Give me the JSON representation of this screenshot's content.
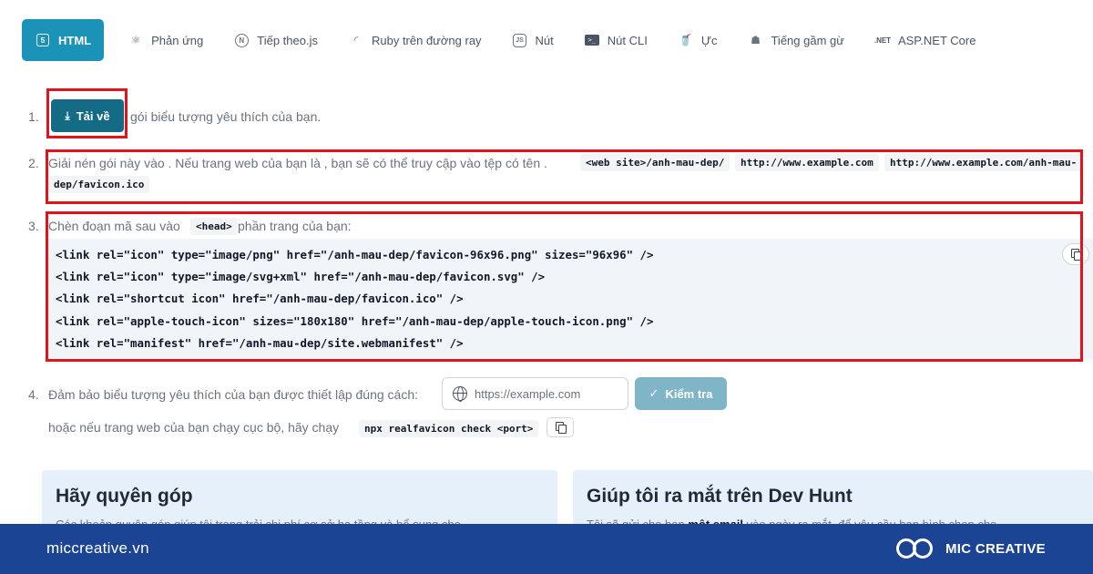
{
  "tabs": [
    {
      "label": "HTML",
      "icon": "html5-icon",
      "active": true
    },
    {
      "label": "Phản ứng",
      "icon": "react-icon"
    },
    {
      "label": "Tiếp theo.js",
      "icon": "nextjs-icon"
    },
    {
      "label": "Ruby trên đường ray",
      "icon": "rails-icon"
    },
    {
      "label": "Nút",
      "icon": "nodejs-icon"
    },
    {
      "label": "Nút CLI",
      "icon": "terminal-icon"
    },
    {
      "label": "Ực",
      "icon": "gulp-icon"
    },
    {
      "label": "Tiếng gầm gừ",
      "icon": "grunt-icon"
    },
    {
      "label": "ASP.NET Core",
      "icon": "dotnet-icon",
      "icon_text": ".NET"
    }
  ],
  "steps": {
    "s1": {
      "num": "1.",
      "button": "Tải về",
      "text": "gói biểu tượng yêu thích của bạn."
    },
    "s2": {
      "num": "2.",
      "text": "Giải nén gói này vào . Nếu trang web của bạn là , bạn sẽ có thể truy cập vào tệp có tên .",
      "chip1": "<web site>/anh-mau-dep/",
      "chip2": "http://www.example.com",
      "chip3a": "http://www.example.com/anh-mau-",
      "chip3b": "dep/favicon.ico"
    },
    "s3": {
      "num": "3.",
      "text_before": "Chèn đoạn mã sau vào",
      "chip": "<head>",
      "text_after": "phần trang của bạn:",
      "code": [
        "<link rel=\"icon\" type=\"image/png\" href=\"/anh-mau-dep/favicon-96x96.png\" sizes=\"96x96\" />",
        "<link rel=\"icon\" type=\"image/svg+xml\" href=\"/anh-mau-dep/favicon.svg\" />",
        "<link rel=\"shortcut icon\" href=\"/anh-mau-dep/favicon.ico\" />",
        "<link rel=\"apple-touch-icon\" sizes=\"180x180\" href=\"/anh-mau-dep/apple-touch-icon.png\" />",
        "<link rel=\"manifest\" href=\"/anh-mau-dep/site.webmanifest\" />"
      ]
    },
    "s4": {
      "num": "4.",
      "text": "Đảm bảo biểu tượng yêu thích của bạn được thiết lập đúng cách:",
      "placeholder": "https://example.com",
      "check_button": "Kiểm tra",
      "local_text": "hoặc nếu trang web của bạn chạy cục bộ, hãy chạy",
      "local_cmd": "npx realfavicon check <port>"
    }
  },
  "cards": {
    "donate": {
      "title": "Hãy quyên góp",
      "text": "Các khoản quyên góp giúp tôi trang trải chi phí cơ sở hạ tầng và bổ sung cho"
    },
    "devhunt": {
      "title": "Giúp tôi ra mắt trên Dev Hunt",
      "text_before": "Tôi sẽ gửi cho bạn",
      "text_bold": "một email",
      "text_after": "vào ngày ra mắt, để yêu cầu bạn bình chọn cho"
    }
  },
  "footer": {
    "site": "miccreative.vn",
    "brand": "MIC CREATIVE"
  },
  "colors": {
    "accent": "#1b92b8",
    "download": "#146b86",
    "highlight": "#e1141c",
    "footer": "#1c4494"
  }
}
